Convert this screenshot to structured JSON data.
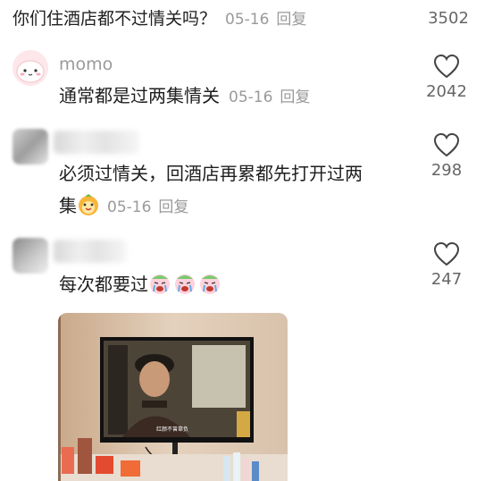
{
  "top_comment": {
    "text": "你们住酒店都不过情关吗？",
    "date": "05-16",
    "reply_label": "回复",
    "likes": "3502"
  },
  "comments": [
    {
      "username": "momo",
      "text": "通常都是过两集情关",
      "date": "05-16",
      "reply_label": "回复",
      "likes": "2042",
      "avatar": "pink-mochi-avatar"
    },
    {
      "username": "",
      "text_line1": "必须过情关，回酒店再累都先打开过两",
      "text_line2": "集",
      "emoji": "smiling-face-emoji",
      "date": "05-16",
      "reply_label": "回复",
      "likes": "298",
      "avatar": "blurred-avatar"
    },
    {
      "username": "",
      "text": "每次都要过",
      "emojis": [
        "crying-face-emoji",
        "crying-face-emoji",
        "crying-face-emoji"
      ],
      "likes": "247",
      "avatar": "blurred-avatar",
      "image": "hotel-tv-photo"
    }
  ],
  "icons": {
    "like": "heart-outline-icon"
  },
  "colors": {
    "text": "#1f1f1f",
    "meta": "#9a9a9a",
    "count": "#666666"
  }
}
